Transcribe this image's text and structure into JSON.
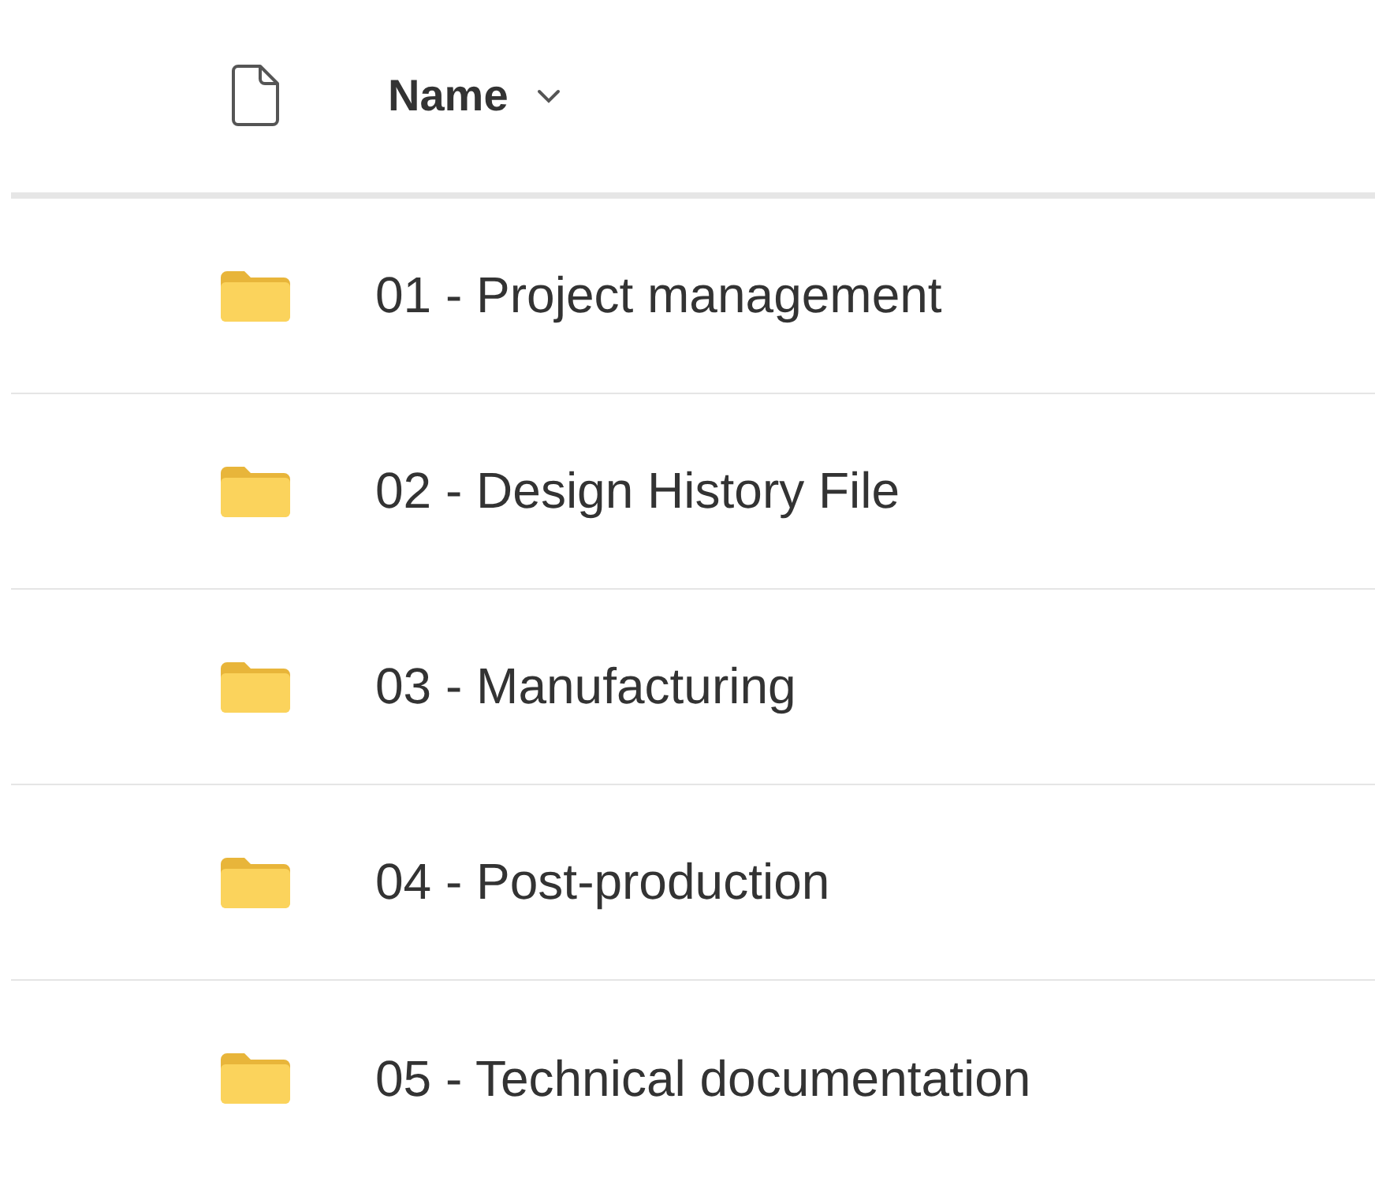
{
  "table": {
    "columns": [
      {
        "kind": "icon"
      },
      {
        "kind": "text",
        "label": "Name"
      }
    ],
    "rows": [
      {
        "name": "01 - Project management"
      },
      {
        "name": "02 - Design History File"
      },
      {
        "name": "03 - Manufacturing"
      },
      {
        "name": "04 - Post-production"
      },
      {
        "name": "05 - Technical documentation"
      }
    ]
  }
}
